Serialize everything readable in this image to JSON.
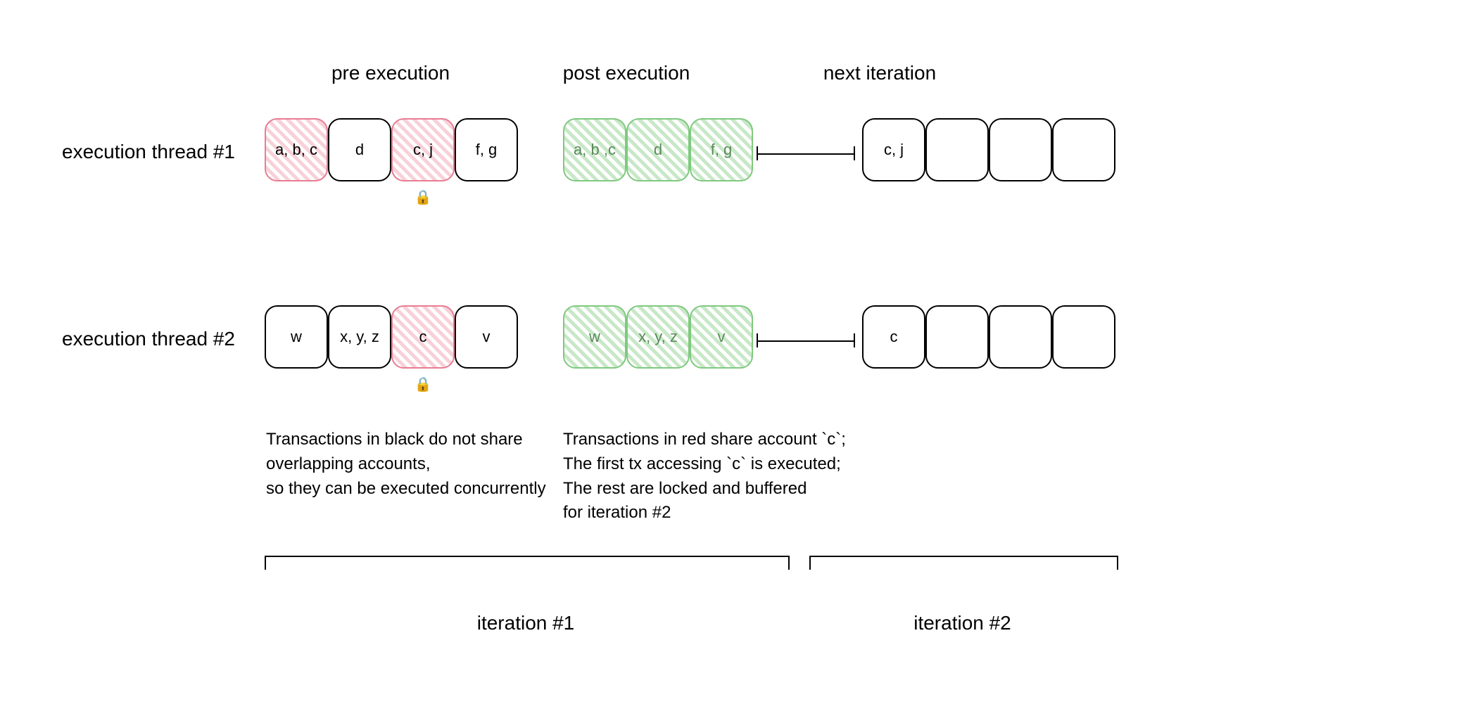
{
  "columns": {
    "pre": "pre execution",
    "post": "post execution",
    "next": "next iteration"
  },
  "rows": {
    "t1": "execution thread #1",
    "t2": "execution thread #2"
  },
  "thread1": {
    "pre": [
      "a, b, c",
      "d",
      "c, j",
      "f, g"
    ],
    "post": [
      "a, b ,c",
      "d",
      "f, g"
    ],
    "next": [
      "c, j",
      "",
      "",
      ""
    ]
  },
  "thread2": {
    "pre": [
      "w",
      "x, y, z",
      "c",
      "v"
    ],
    "post": [
      "w",
      "x, y, z",
      "v"
    ],
    "next": [
      "c",
      "",
      "",
      ""
    ]
  },
  "captions": {
    "left": "Transactions in black do not share\noverlapping accounts,\nso they can be executed concurrently",
    "right": "Transactions in red share account `c`;\nThe first tx accessing `c` is executed;\nThe rest are locked and buffered\nfor iteration #2"
  },
  "iterations": {
    "it1": "iteration #1",
    "it2": "iteration #2"
  },
  "lock_glyph": "🔒"
}
